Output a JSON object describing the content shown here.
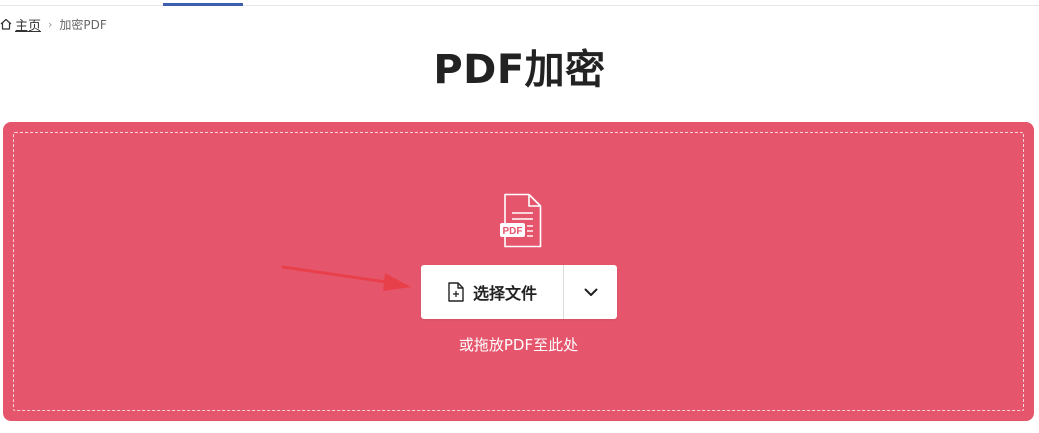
{
  "breadcrumb": {
    "home_label": "主页",
    "separator": "›",
    "current": "加密PDF"
  },
  "page": {
    "title": "PDF加密"
  },
  "upload": {
    "choose_label": "选择文件",
    "drop_hint": "或拖放PDF至此处",
    "file_badge": "PDF"
  },
  "colors": {
    "dropzone": "#e5566d",
    "nav_active": "#3d5fae",
    "annotation_arrow": "#e8404a"
  },
  "icons": {
    "home": "home-icon",
    "file": "pdf-file-icon",
    "add_file": "file-add-icon",
    "dropdown": "chevron-down-icon",
    "arrow": "annotation-arrow"
  }
}
